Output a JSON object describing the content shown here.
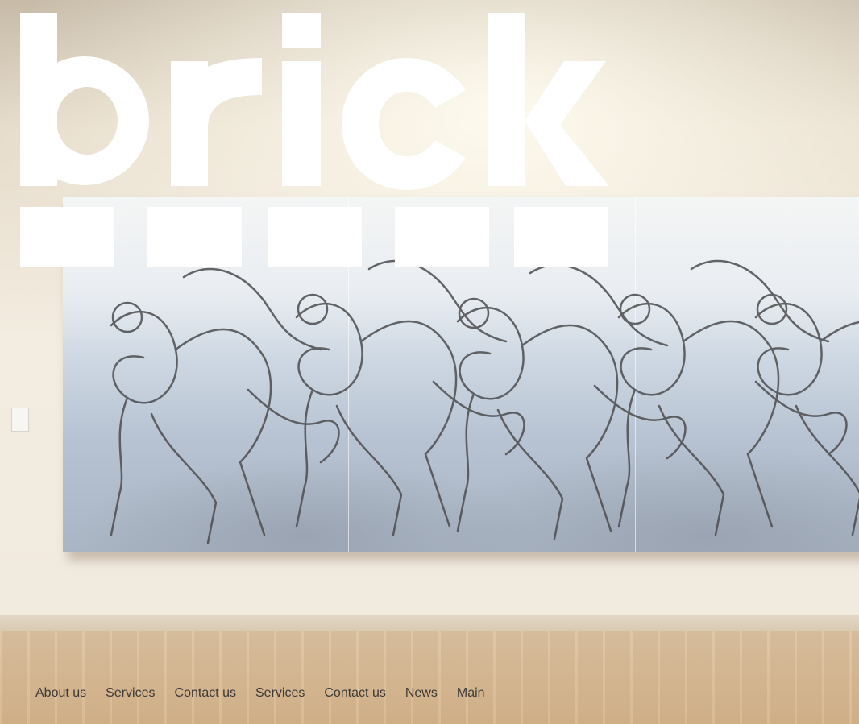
{
  "brand": {
    "name": "brick"
  },
  "nav": {
    "items": [
      {
        "label": "About us"
      },
      {
        "label": "Services"
      },
      {
        "label": "Contact us"
      },
      {
        "label": "Services"
      },
      {
        "label": "Contact us"
      },
      {
        "label": "News"
      },
      {
        "label": "Main"
      }
    ]
  },
  "hero": {
    "image": "gallery-wall-painting"
  },
  "colors": {
    "logo": "#ffffff",
    "nav_text": "#3d3a36"
  }
}
